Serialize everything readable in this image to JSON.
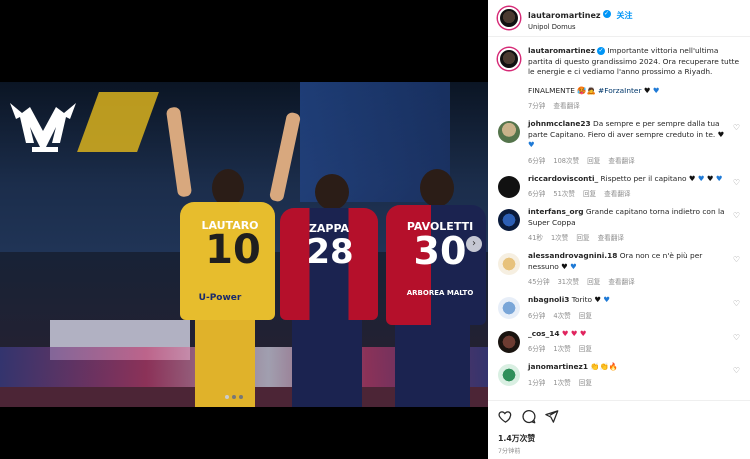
{
  "media": {
    "logo_alt": "LM",
    "players": [
      {
        "name": "LAUTARO",
        "number": "10"
      },
      {
        "name": "ZAPPA",
        "number": "28"
      },
      {
        "name": "PAVOLETTI",
        "number": "30"
      }
    ],
    "sponsor_left": "U-Power",
    "sponsor_right": "ARBOREA MALTO"
  },
  "post_header": {
    "username": "lautaromartinez",
    "follow_label": "关注",
    "location": "Unipol Domus"
  },
  "caption": {
    "username": "lautaromartinez",
    "text": "Importante vittoria nell'ultima partita di questo grandissimo 2024. Ora recuperare tutte le energie e ci vediamo l'anno prossimo a Riyadh.",
    "extra_text": "FINALMENTE 🥵🙇",
    "hashtag": "#ForzaInter",
    "time": "7分钟",
    "translate_label": "查看翻译"
  },
  "comments": [
    {
      "username": "johnmcclane23",
      "text": "Da sempre e per sempre dalla tua parte Capitano. Fiero di aver sempre creduto in te.",
      "hearts": [
        "black",
        "blue"
      ],
      "time": "6分钟",
      "likes": "108次赞",
      "reply": "回复",
      "translate": "查看翻译"
    },
    {
      "username": "riccardovisconti_",
      "text": "Rispetto per il capitano",
      "hearts": [
        "black",
        "blue",
        "black",
        "blue"
      ],
      "time": "6分钟",
      "likes": "51次赞",
      "reply": "回复",
      "translate": "查看翻译"
    },
    {
      "username": "interfans_org",
      "text": "Grande capitano torna indietro con la Super Coppa",
      "hearts": [],
      "time": "41秒",
      "likes": "1次赞",
      "reply": "回复",
      "translate": "查看翻译"
    },
    {
      "username": "alessandrovagnini.18",
      "text": "Ora non ce n'è più per nessuno",
      "hearts": [
        "black",
        "blue"
      ],
      "time": "45分钟",
      "likes": "31次赞",
      "reply": "回复",
      "translate": "查看翻译"
    },
    {
      "username": "nbagnoli3",
      "text": "Torito",
      "hearts": [
        "black",
        "blue"
      ],
      "time": "6分钟",
      "likes": "4次赞",
      "reply": "回复",
      "translate": ""
    },
    {
      "username": "_cos_14",
      "text": "",
      "hearts": [
        "red",
        "red",
        "red"
      ],
      "time": "6分钟",
      "likes": "1次赞",
      "reply": "回复",
      "translate": ""
    },
    {
      "username": "janomartinez1",
      "text": "👏👏🔥",
      "hearts": [],
      "time": "1分钟",
      "likes": "1次赞",
      "reply": "回复",
      "translate": ""
    }
  ],
  "actions": {
    "views": "1.4万次赞",
    "date": "7分钟前"
  },
  "colors": {
    "accent": "#0095f6",
    "heart_blue": "#1f7ad6",
    "heart_black": "#111111",
    "heart_red": "#e0245e"
  }
}
